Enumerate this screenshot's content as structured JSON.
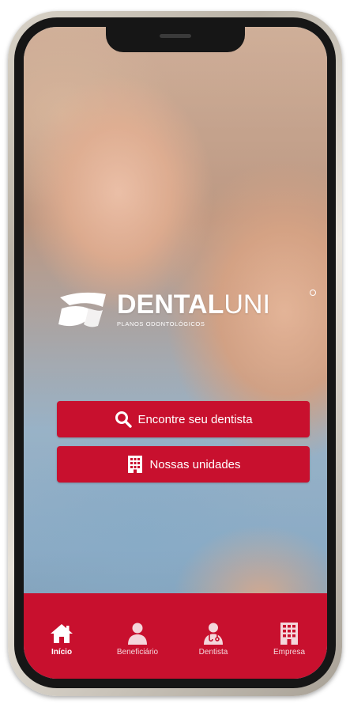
{
  "app": {
    "brand_name_bold": "DENTAL",
    "brand_name_light": "UNI",
    "brand_tagline": "PLANOS ODONTOLÓGICOS",
    "accent_color": "#c8102e"
  },
  "actions": [
    {
      "label": "Encontre seu dentista",
      "icon": "search-icon"
    },
    {
      "label": "Nossas unidades",
      "icon": "building-icon"
    }
  ],
  "bottom_nav": {
    "items": [
      {
        "label": "Início",
        "icon": "home-icon",
        "active": true
      },
      {
        "label": "Beneficiário",
        "icon": "person-icon",
        "active": false
      },
      {
        "label": "Dentista",
        "icon": "doctor-icon",
        "active": false
      },
      {
        "label": "Empresa",
        "icon": "office-building-icon",
        "active": false
      }
    ]
  }
}
